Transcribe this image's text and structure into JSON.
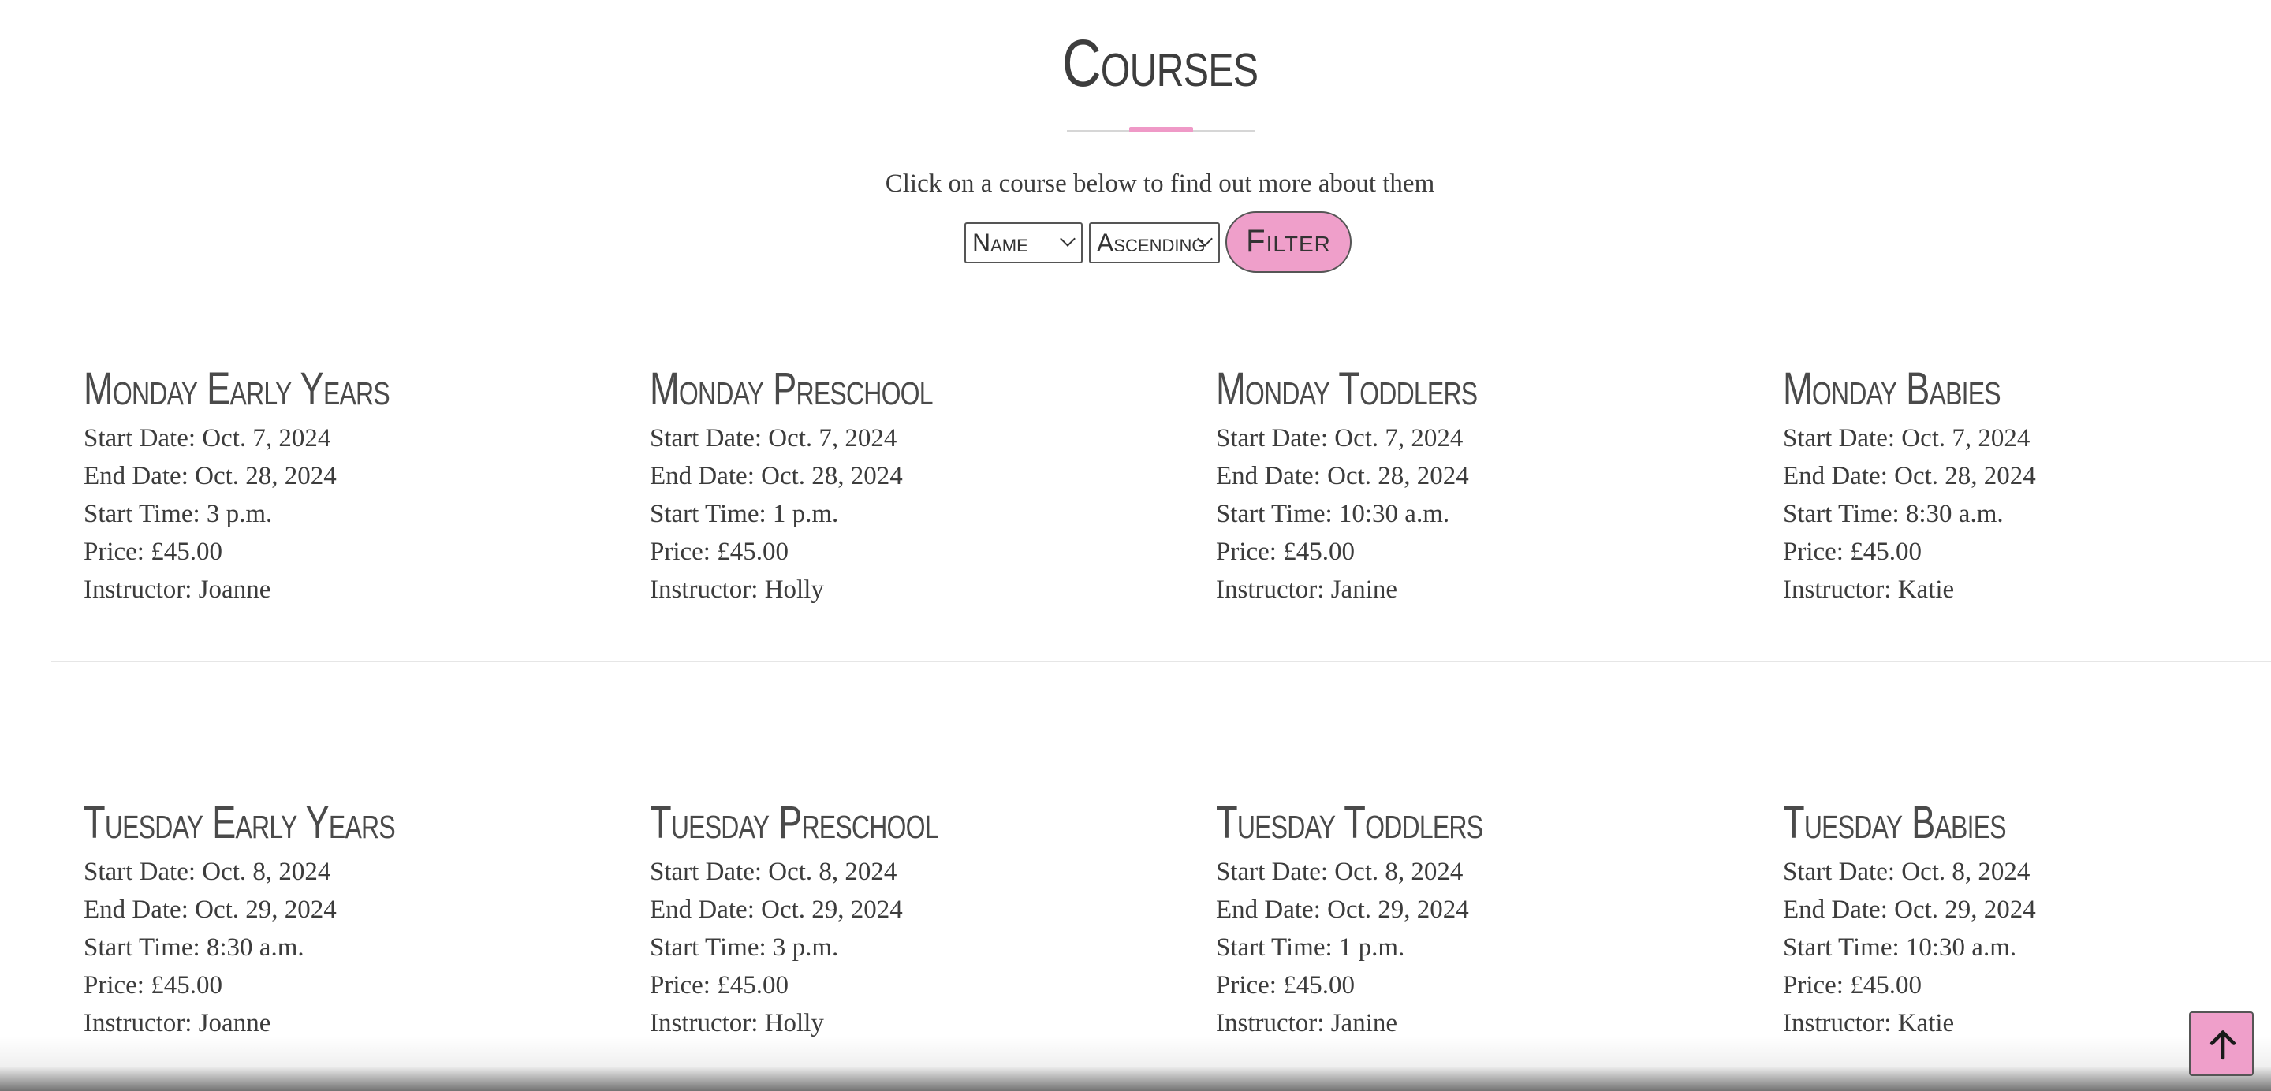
{
  "header": {
    "title": "Courses",
    "subtitle": "Click on a course below to find out more about them"
  },
  "filter": {
    "sort_field": "Name",
    "sort_order": "Ascending",
    "button_label": "Filter"
  },
  "labels": {
    "start_date": "Start Date:",
    "end_date": "End Date:",
    "start_time": "Start Time:",
    "price": "Price:",
    "instructor": "Instructor:"
  },
  "courses": [
    {
      "name": "Monday Early Years",
      "start_date": "Start Date: Oct. 7, 2024",
      "end_date": "End Date: Oct. 28, 2024",
      "start_time": "Start Time: 3 p.m.",
      "price": "Price: £45.00",
      "instructor": "Instructor: Joanne"
    },
    {
      "name": "Monday Preschool",
      "start_date": "Start Date: Oct. 7, 2024",
      "end_date": "End Date: Oct. 28, 2024",
      "start_time": "Start Time: 1 p.m.",
      "price": "Price: £45.00",
      "instructor": "Instructor: Holly"
    },
    {
      "name": "Monday Toddlers",
      "start_date": "Start Date: Oct. 7, 2024",
      "end_date": "End Date: Oct. 28, 2024",
      "start_time": "Start Time: 10:30 a.m.",
      "price": "Price: £45.00",
      "instructor": "Instructor: Janine"
    },
    {
      "name": "Monday Babies",
      "start_date": "Start Date: Oct. 7, 2024",
      "end_date": "End Date: Oct. 28, 2024",
      "start_time": "Start Time: 8:30 a.m.",
      "price": "Price: £45.00",
      "instructor": "Instructor: Katie"
    },
    {
      "name": "Tuesday Early Years",
      "start_date": "Start Date: Oct. 8, 2024",
      "end_date": "End Date: Oct. 29, 2024",
      "start_time": "Start Time: 8:30 a.m.",
      "price": "Price: £45.00",
      "instructor": "Instructor: Joanne"
    },
    {
      "name": "Tuesday Preschool",
      "start_date": "Start Date: Oct. 8, 2024",
      "end_date": "End Date: Oct. 29, 2024",
      "start_time": "Start Time: 3 p.m.",
      "price": "Price: £45.00",
      "instructor": "Instructor: Holly"
    },
    {
      "name": "Tuesday Toddlers",
      "start_date": "Start Date: Oct. 8, 2024",
      "end_date": "End Date: Oct. 29, 2024",
      "start_time": "Start Time: 1 p.m.",
      "price": "Price: £45.00",
      "instructor": "Instructor: Janine"
    },
    {
      "name": "Tuesday Babies",
      "start_date": "Start Date: Oct. 8, 2024",
      "end_date": "End Date: Oct. 29, 2024",
      "start_time": "Start Time: 10:30 a.m.",
      "price": "Price: £45.00",
      "instructor": "Instructor: Katie"
    }
  ],
  "back_to_top": {
    "icon": "arrow-up-icon"
  },
  "colors": {
    "accent": "#ef9fca",
    "text": "#3c3c3c",
    "heading": "#4a4a4a",
    "divider": "#e6e6e6"
  }
}
